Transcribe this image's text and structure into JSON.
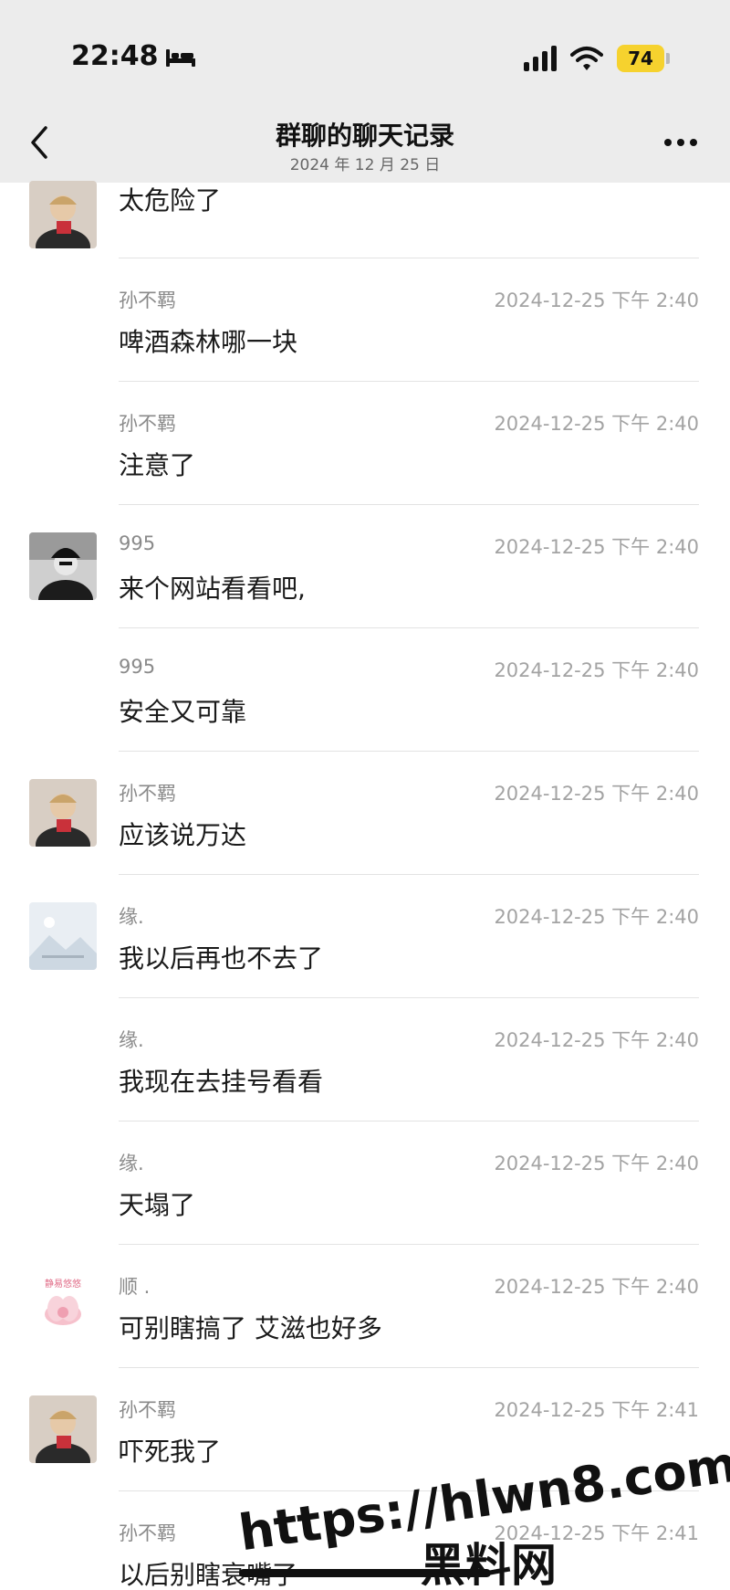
{
  "status_bar": {
    "time": "22:48",
    "battery": "74"
  },
  "nav": {
    "title": "群聊的聊天记录",
    "date": "2024 年 12 月 25 日"
  },
  "messages": [
    {
      "sender": "",
      "time": "",
      "text": "太危险了",
      "avatar": "avatar-sun"
    },
    {
      "sender": "孙不羁",
      "time": "2024-12-25 下午 2:40",
      "text": "啤酒森林哪一块",
      "avatar": ""
    },
    {
      "sender": "孙不羁",
      "time": "2024-12-25 下午 2:40",
      "text": "注意了",
      "avatar": ""
    },
    {
      "sender": "995",
      "time": "2024-12-25 下午 2:40",
      "text": "来个网站看看吧,",
      "avatar": "avatar-995"
    },
    {
      "sender": "995",
      "time": "2024-12-25 下午 2:40",
      "text": "安全又可靠",
      "avatar": ""
    },
    {
      "sender": "孙不羁",
      "time": "2024-12-25 下午 2:40",
      "text": "应该说万达",
      "avatar": "avatar-sun"
    },
    {
      "sender": "缘.",
      "time": "2024-12-25 下午 2:40",
      "text": "我以后再也不去了",
      "avatar": "avatar-yuan"
    },
    {
      "sender": "缘.",
      "time": "2024-12-25 下午 2:40",
      "text": "我现在去挂号看看",
      "avatar": ""
    },
    {
      "sender": "缘.",
      "time": "2024-12-25 下午 2:40",
      "text": "天塌了",
      "avatar": ""
    },
    {
      "sender": "顺 .",
      "time": "2024-12-25 下午 2:40",
      "text": "可别瞎搞了 艾滋也好多",
      "avatar": "avatar-shun"
    },
    {
      "sender": "孙不羁",
      "time": "2024-12-25 下午 2:41",
      "text": "吓死我了",
      "avatar": "avatar-sun"
    },
    {
      "sender": "孙不羁",
      "time": "2024-12-25 下午 2:41",
      "text": "以后别瞎衰嘴了",
      "avatar": ""
    }
  ],
  "avatar_labels": {
    "shun": "静易悠悠"
  },
  "watermark": {
    "url": "https://hlwn8.com",
    "name": "黑料网"
  }
}
